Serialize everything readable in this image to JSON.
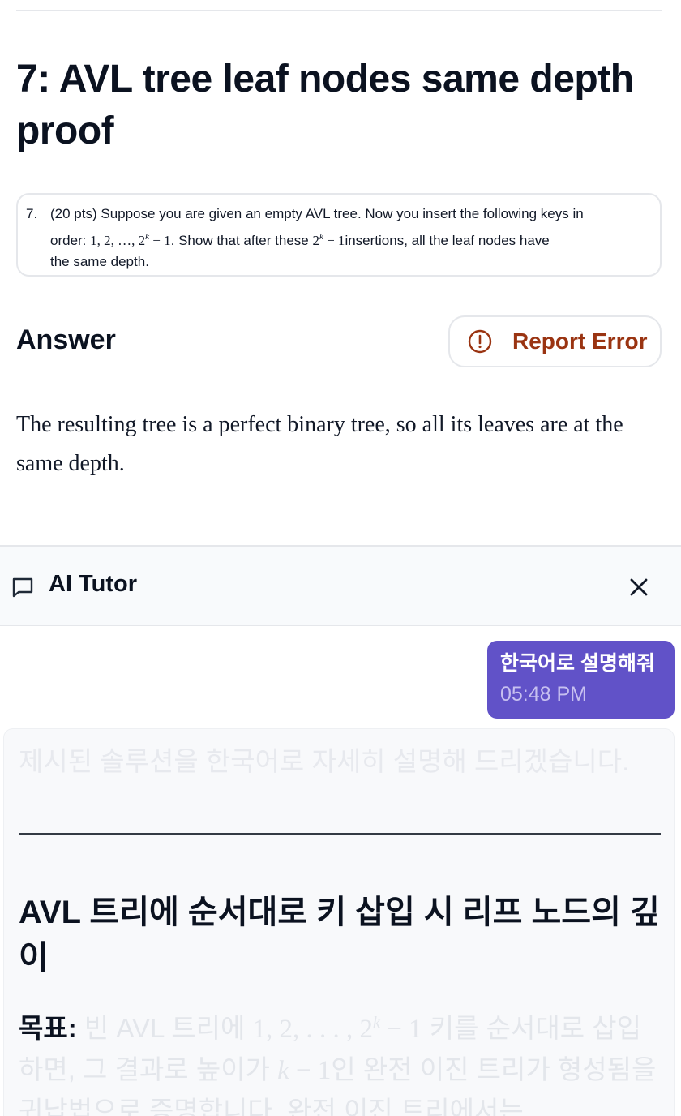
{
  "page": {
    "title": "7: AVL tree leaf nodes same depth proof"
  },
  "problem": {
    "number": "7.",
    "line1": "(20 pts) Suppose you are given an empty AVL tree. Now you insert the following keys in",
    "order_prefix": "order: ",
    "keys_math": "1, 2, …, 2",
    "exp": "k",
    "minus_one": " − 1",
    "show_text": ". Show that after these ",
    "count_math": "2",
    "count_exp": "k",
    "count_rest": " − 1",
    "line2_tail": "insertions, all the leaf nodes have",
    "line3": "the same depth."
  },
  "answer": {
    "heading": "Answer",
    "report_label": "Report Error",
    "text": "The resulting tree is a perfect binary tree, so all its leaves are at the same depth."
  },
  "tutor": {
    "title": "AI Tutor",
    "user_message": "한국어로 설명해줘",
    "user_time": "05:48 PM",
    "ai_intro": "제시된 솔루션을 한국어로 자세히 설명해 드리겠습니다.",
    "ai_heading": "AVL 트리에 순서대로 키 삽입 시 리프 노드의 깊이",
    "goal_label": "목표:",
    "goal_text_1": " 빈 AVL 트리에 ",
    "goal_math": "1, 2, . . . , 2",
    "goal_exp": "k",
    "goal_math_tail": " − 1",
    "goal_text_2": " 키를 순서대로 삽입하면, 그 결과로 높이가 ",
    "goal_k": "k",
    "goal_k_tail": " − 1",
    "goal_text_3": "인 완전 이진 트리가 형성됨을 귀납법으로 증명합니다. 완전 이진 트리에서는"
  },
  "colors": {
    "accent": "#6152c8",
    "report": "#9a3412",
    "border": "#e5e7eb"
  },
  "icons": [
    "alert-circle-icon",
    "chat-bubble-icon",
    "close-icon"
  ]
}
